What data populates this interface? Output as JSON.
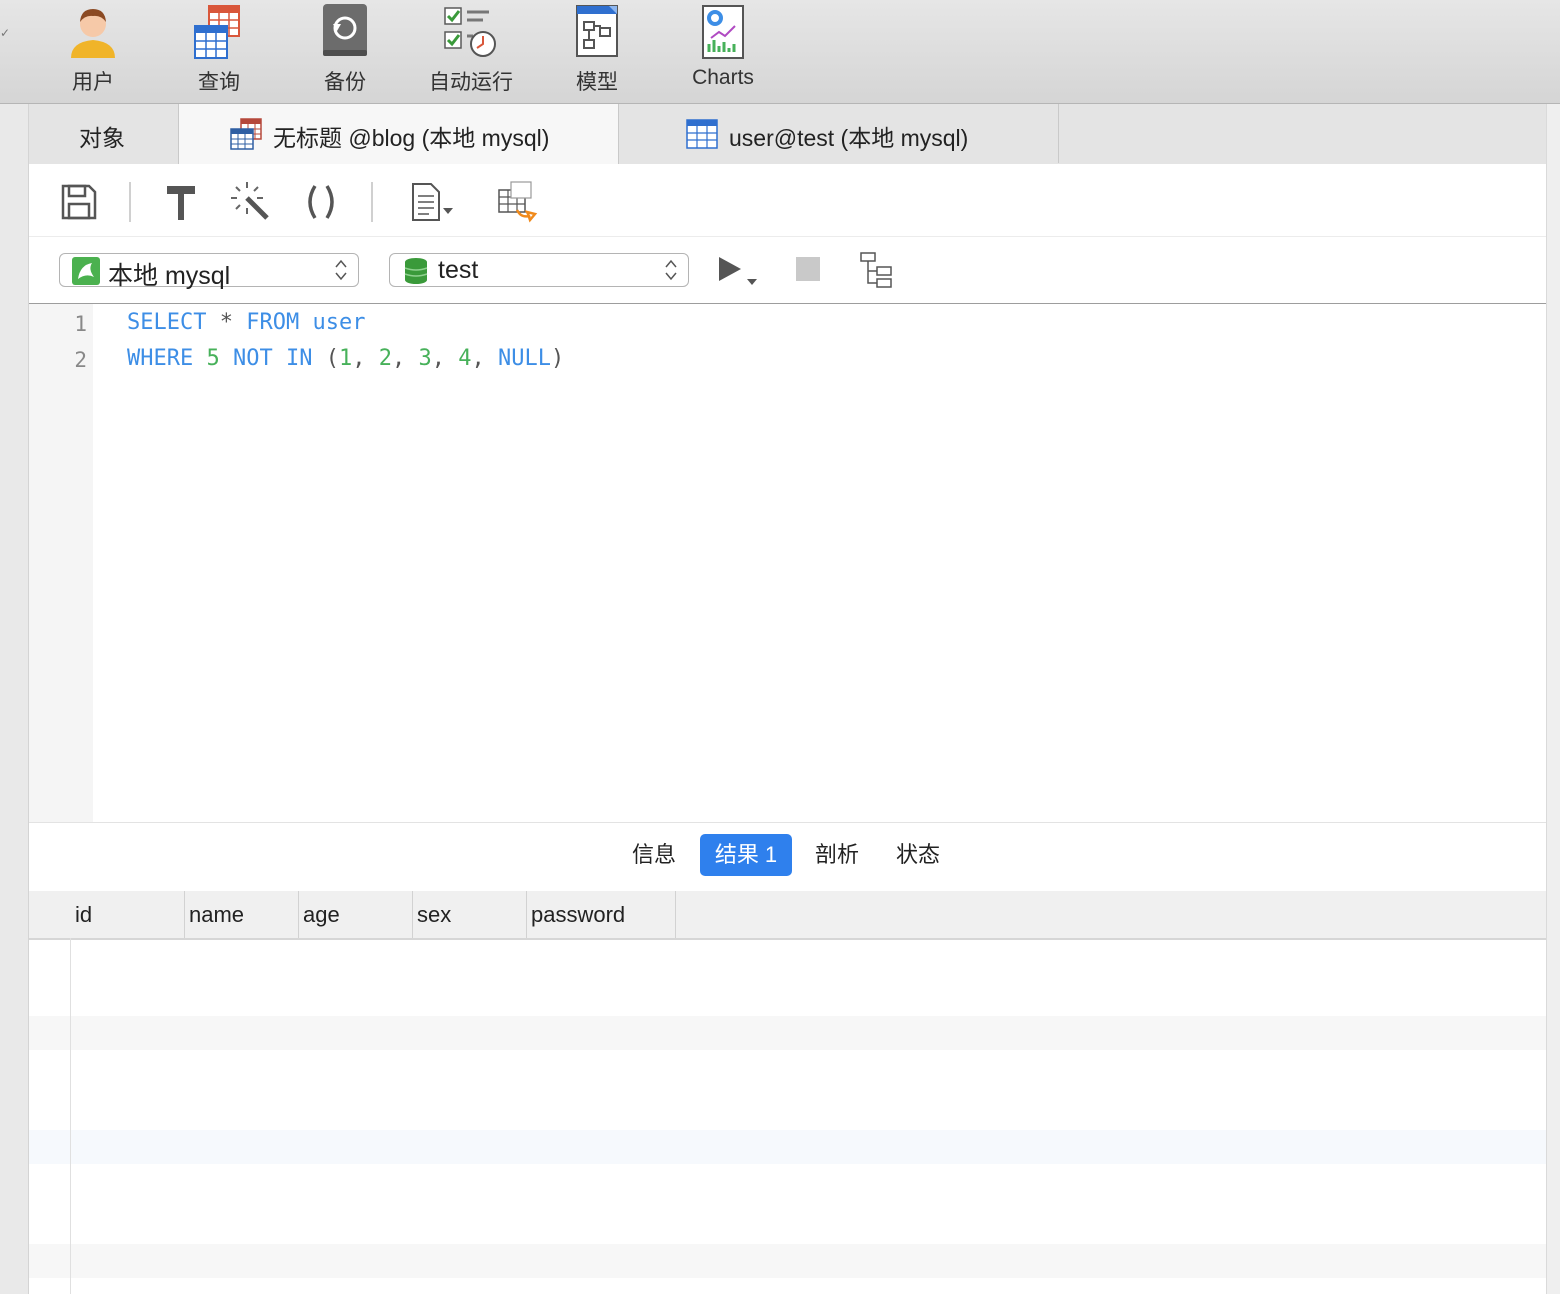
{
  "toolbar": {
    "items": [
      {
        "label": "用户",
        "icon": "user-icon"
      },
      {
        "label": "查询",
        "icon": "query-icon"
      },
      {
        "label": "备份",
        "icon": "backup-icon"
      },
      {
        "label": "自动运行",
        "icon": "automation-icon"
      },
      {
        "label": "模型",
        "icon": "model-icon"
      },
      {
        "label": "Charts",
        "icon": "charts-icon"
      }
    ]
  },
  "tabs": [
    {
      "label": "对象"
    },
    {
      "label": "无标题 @blog (本地 mysql)",
      "icon": "query-table-icon"
    },
    {
      "label": "user@test (本地 mysql)",
      "icon": "table-icon"
    }
  ],
  "editor_toolbar": {
    "icons": [
      "save-icon",
      "hammer-icon",
      "magic-wand-icon",
      "parentheses-icon",
      "document-icon",
      "export-table-icon"
    ]
  },
  "connection": {
    "value": "本地 mysql",
    "icon": "mysql-connection-icon"
  },
  "database": {
    "value": "test",
    "icon": "database-icon"
  },
  "run_controls": {
    "icons": [
      "run-icon",
      "stop-icon",
      "explain-icon"
    ]
  },
  "code": {
    "line_numbers": [
      "1",
      "2"
    ],
    "lines": [
      [
        {
          "t": "SELECT",
          "c": "kw"
        },
        {
          "t": " ",
          "c": "op"
        },
        {
          "t": "*",
          "c": "op"
        },
        {
          "t": " ",
          "c": "op"
        },
        {
          "t": "FROM",
          "c": "kw"
        },
        {
          "t": " ",
          "c": "op"
        },
        {
          "t": "user",
          "c": "kw"
        }
      ],
      [
        {
          "t": "WHERE",
          "c": "kw"
        },
        {
          "t": " ",
          "c": "op"
        },
        {
          "t": "5",
          "c": "num"
        },
        {
          "t": " ",
          "c": "op"
        },
        {
          "t": "NOT",
          "c": "kw"
        },
        {
          "t": " ",
          "c": "op"
        },
        {
          "t": "IN",
          "c": "kw"
        },
        {
          "t": " (",
          "c": "op"
        },
        {
          "t": "1",
          "c": "num"
        },
        {
          "t": ", ",
          "c": "op"
        },
        {
          "t": "2",
          "c": "num"
        },
        {
          "t": ", ",
          "c": "op"
        },
        {
          "t": "3",
          "c": "num"
        },
        {
          "t": ", ",
          "c": "op"
        },
        {
          "t": "4",
          "c": "num"
        },
        {
          "t": ", ",
          "c": "op"
        },
        {
          "t": "NULL",
          "c": "kw"
        },
        {
          "t": ")",
          "c": "op"
        }
      ]
    ]
  },
  "result_tabs": [
    {
      "label": "信息",
      "active": false
    },
    {
      "label": "结果 1",
      "active": true
    },
    {
      "label": "剖析",
      "active": false
    },
    {
      "label": "状态",
      "active": false
    }
  ],
  "grid": {
    "columns": [
      "id",
      "name",
      "age",
      "sex",
      "password"
    ],
    "rows": []
  },
  "colors": {
    "accent": "#2f80ed",
    "keyword": "#3d8ee6",
    "number": "#47b15a"
  }
}
